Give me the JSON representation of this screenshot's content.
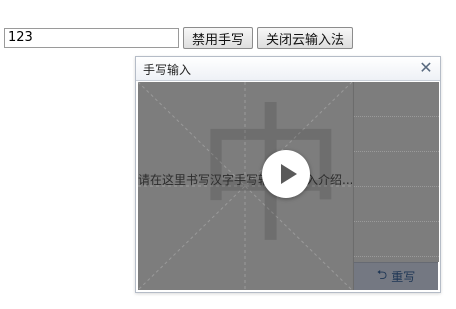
{
  "toolbar": {
    "input_value": "123",
    "disable_handwriting_label": "禁用手写",
    "close_cloud_ime_label": "关闭云输入法"
  },
  "handwriting_panel": {
    "title": "手写输入",
    "close_icon": "close-icon",
    "canvas_watermark": "中",
    "hint_text": "请在这里书写汉字",
    "candidate_cell_count": 5,
    "rewrite_label": "重写",
    "rewrite_icon": "undo-arrow-icon"
  },
  "video_overlay": {
    "title_text": "手写输入法截入介绍...",
    "play_icon": "play-icon"
  },
  "colors": {
    "overlay_gray": "#7d7d7d",
    "rewrite_text": "#1d3554",
    "panel_border": "#b5bcc7"
  }
}
